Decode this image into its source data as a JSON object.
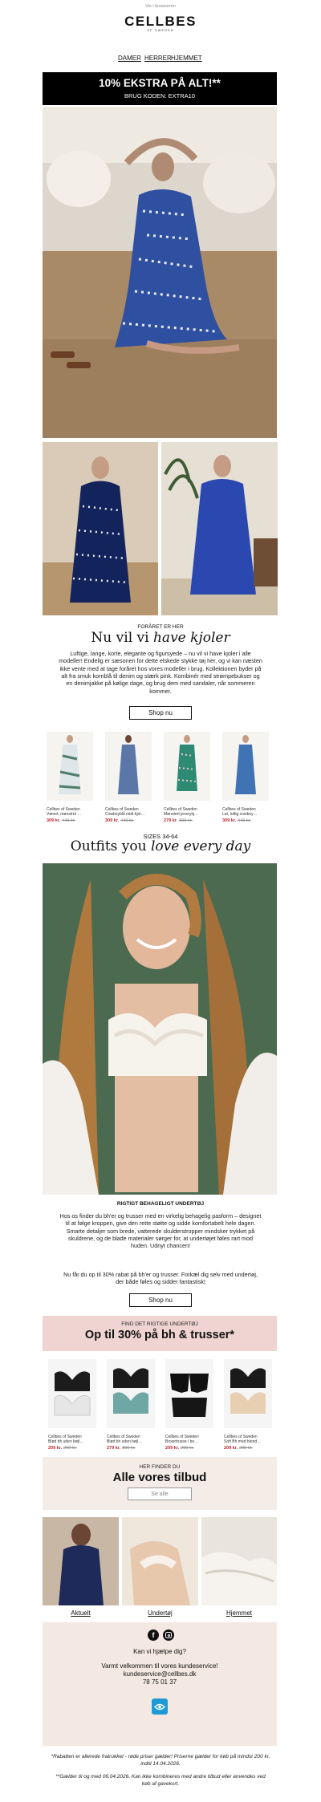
{
  "header": {
    "browser_link": "Vis i browseren",
    "brand": "CELLBES",
    "brand_sub": "OF SWEDEN",
    "nav": [
      "DAMER",
      "HERRER",
      "HJEMMET"
    ]
  },
  "promo_banner": {
    "title": "10% EKSTRA PÅ ALT!**",
    "code_text": "BRUG KODEN: EXTRA10"
  },
  "dresses": {
    "kicker": "FORÅRET ER HER",
    "headline_plain": "Nu vil vi ",
    "headline_italic": "have kjoler",
    "body": "Luftige, lange, korte, elegante og figursyede – nu vil vi have kjoler i alle modeller! Endelig er sæsonen for dette elskede stykke tøj her, og vi kan næsten ikke vente med at tage foråret hos vores modeller i brug. Kollektionen byder på alt fra smuk kornblå til denim og stærk pink. Kombinér med strømpebukser og en denimjakke på kølige dage, og brug dem med sandaler, når sommeren kommer.",
    "button": "Shop nu",
    "products": [
      {
        "brand": "Cellbes of Sweden",
        "name": "Vævet, mønstret …",
        "price": "309 kr.",
        "old_price": "449 kr."
      },
      {
        "brand": "Cellbes of Sweden",
        "name": "Cowboyblå midi-kjol…",
        "price": "309 kr.",
        "old_price": "449 kr."
      },
      {
        "brand": "Cellbes of Sweden",
        "name": "Mønstret jerseykj…",
        "price": "279 kr.",
        "old_price": "399 kr."
      },
      {
        "brand": "Cellbes of Sweden",
        "name": "Let, luftig cowboy…",
        "price": "309 kr.",
        "old_price": "449 kr."
      }
    ]
  },
  "outfits": {
    "kicker": "SIZES 34-64",
    "headline_plain": "Outfits you ",
    "headline_italic": "love every day"
  },
  "underwear": {
    "kicker": "RIGTIGT BEHAGELIGT UNDERTØJ",
    "body1": "Hos os finder du bh'er og trusser med en virkelig behagelig pasform – designet til at følge kroppen, give den rette støtte og sidde komfortabelt hele dagen. Smarte detaljer som brede, vatterede skulderstropper mindsker trykket på skuldrene, og de blade materialer sørger for, at undertøjet føles rart mod huden. Udnyt chancen!",
    "body2": "Nu får du op til 30% rabat på bh'er og trusser. Forkæl dig selv med undertøj, der både føles og sidder fantastisk!",
    "button": "Shop nu"
  },
  "offer_box": {
    "kicker": "FIND DET RIGTIGE UNDERTØJ",
    "title": "Op til 30% på bh & trusser*"
  },
  "lingerie_products": [
    {
      "brand": "Cellbes of Sweden",
      "name": "Blød bh uden bøjl…",
      "price": "209 kr.",
      "old_price": "299 kr."
    },
    {
      "brand": "Cellbes of Sweden",
      "name": "Blød bh uden bøjl…",
      "price": "279 kr.",
      "old_price": "399 kr."
    },
    {
      "brand": "Cellbes of Sweden",
      "name": "Boxertrusse i bo…",
      "price": "209 kr.",
      "old_price": "299 kr."
    },
    {
      "brand": "Cellbes of Sweden",
      "name": "Soft Bh med blond…",
      "price": "209 kr.",
      "old_price": "299 kr."
    }
  ],
  "all_offers": {
    "kicker": "HER FINDER DU",
    "title": "Alle vores tilbud",
    "button": "Se alle"
  },
  "categories": [
    "Aktuelt",
    "Undertøj",
    "Hjemmet"
  ],
  "footer": {
    "help": "Kan vi hjælpe dig?",
    "welcome": "Varmt velkommen til vores kundeservice!",
    "email": "kundeservice@cellbes.dk",
    "phone": "78 75 01 37",
    "note1": "*Rabatten er allerede fratrukket - røde priser gælder! Priserne gælder for køb på mindst 200 kr. indtil 14.04.2026.",
    "note2": "**Gælder til og med 06.04.2026. Kan ikke kombineres med andre tilbud eller anvendes ved køb af gavekort."
  },
  "colors": {
    "accent_red": "#c0282d",
    "pink_box": "#f0d4d2",
    "beige_box": "#f4ece6",
    "footer_bg": "#f3e9e2",
    "banner_bg": "#000000"
  }
}
